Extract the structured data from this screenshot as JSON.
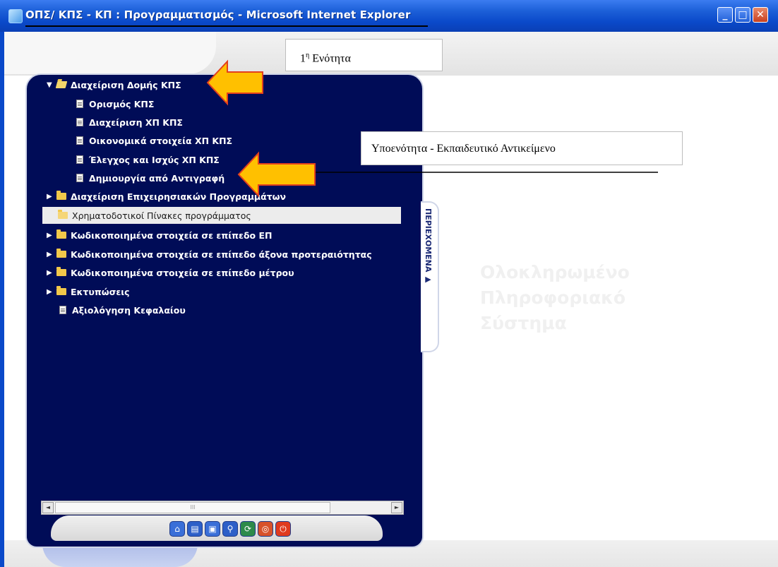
{
  "window": {
    "title": "ΟΠΣ/ ΚΠΣ - ΚΠ : Προγραμματισμός - Microsoft Internet Explorer",
    "buttons": {
      "minimize_icon": "minimize-icon",
      "maximize_icon": "maximize-icon",
      "close_icon": "close-icon"
    }
  },
  "callouts": {
    "section_prefix": "1",
    "section_sup": "η",
    "section_word": " Ενότητα",
    "subsection": "Υποενότητα - Εκπαιδευτικό Αντικείμενο"
  },
  "tree": {
    "items": [
      {
        "label": "Διαχείριση Δομής ΚΠΣ",
        "kind": "folder-open",
        "expanded": true
      },
      {
        "label": "Ορισμός ΚΠΣ",
        "kind": "doc"
      },
      {
        "label": "Διαχείριση ΧΠ ΚΠΣ",
        "kind": "doc"
      },
      {
        "label": "Οικονομικά στοιχεία ΧΠ ΚΠΣ",
        "kind": "doc"
      },
      {
        "label": "Έλεγχος και Ισχύς ΧΠ ΚΠΣ",
        "kind": "doc"
      },
      {
        "label": "Δημιουργία από Αντιγραφή",
        "kind": "doc"
      },
      {
        "label": "Διαχείριση Επιχειρησιακών Προγραμμάτων",
        "kind": "folder"
      },
      {
        "label": "Χρηματοδοτικοί Πίνακες προγράμματος",
        "kind": "folder",
        "selected": true
      },
      {
        "label": "Κωδικοποιημένα στοιχεία σε επίπεδο ΕΠ",
        "kind": "folder"
      },
      {
        "label": "Κωδικοποιημένα στοιχεία σε επίπεδο άξονα προτεραιότητας",
        "kind": "folder"
      },
      {
        "label": "Κωδικοποιημένα στοιχεία σε επίπεδο μέτρου",
        "kind": "folder"
      },
      {
        "label": "Εκτυπώσεις",
        "kind": "folder"
      },
      {
        "label": "Αξιολόγηση Κεφαλαίου",
        "kind": "doc"
      }
    ]
  },
  "side_tab": {
    "label": "ΠΕΡΙΕΧΟΜΕΝΑ ▶"
  },
  "watermark": {
    "line1": "Ολοκληρωμένο",
    "line2": "Πληροφοριακό",
    "line3": "Σύστημα"
  },
  "scrollbar": {
    "thumb_grip": "III",
    "left_arrow": "◄",
    "right_arrow": "►"
  },
  "toolbar": {
    "buttons": [
      {
        "icon": "home-icon",
        "color": "#3a6fd8"
      },
      {
        "icon": "book-icon",
        "color": "#2d5fc8"
      },
      {
        "icon": "package-icon",
        "color": "#3a6fd8"
      },
      {
        "icon": "search-icon",
        "color": "#2d5fc8"
      },
      {
        "icon": "refresh-icon",
        "color": "#2d8a4a"
      },
      {
        "icon": "lifebuoy-icon",
        "color": "#d8522a"
      },
      {
        "icon": "power-icon",
        "color": "#e03a1e"
      }
    ]
  },
  "colors": {
    "panel_bg": "#000c57",
    "titlebar": "#0a49c9",
    "arrow_fill": "#ffc000",
    "arrow_border": "#e3401d"
  }
}
